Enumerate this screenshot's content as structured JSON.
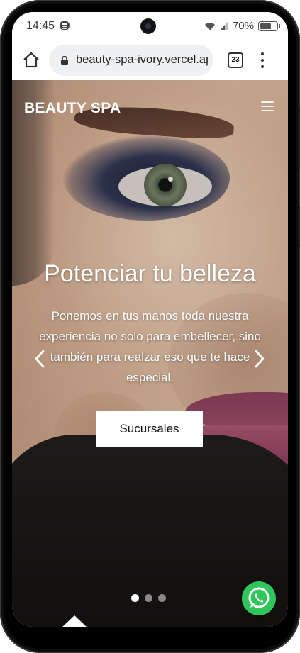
{
  "status_bar": {
    "time": "14:45",
    "battery": "70%"
  },
  "browser": {
    "url": "beauty-spa-ivory.vercel.ap",
    "tab_count": "23"
  },
  "site": {
    "brand": "BEAUTY SPA",
    "hero": {
      "title": "Potenciar tu belleza",
      "description": "Ponemos en tus manos toda nuestra experiencia no solo para embellecer, sino también para realzar eso que te hace especial.",
      "cta_label": "Sucursales",
      "slides_total": 3,
      "active_slide": 1
    }
  },
  "colors": {
    "whatsapp": "#2fc55a",
    "text": "#ffffff"
  },
  "icons": [
    "spotify-icon",
    "wifi-icon",
    "signal-icon",
    "battery-icon",
    "home-icon",
    "lock-icon",
    "tabs-icon",
    "more-vert-icon",
    "hamburger-menu-icon",
    "chevron-left-icon",
    "chevron-right-icon",
    "whatsapp-icon"
  ]
}
